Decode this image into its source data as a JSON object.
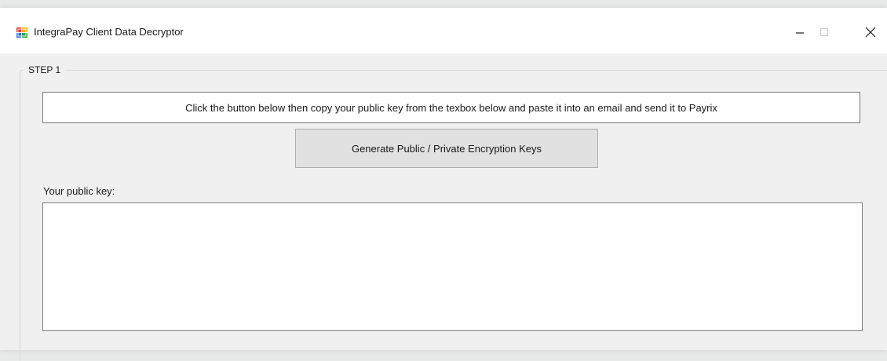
{
  "window": {
    "title": "IntegraPay Client Data Decryptor",
    "controls": {
      "minimize_icon": "minimize-icon",
      "maximize_icon": "maximize-icon",
      "close_icon": "close-icon"
    },
    "app_icon": "app-icon"
  },
  "step1": {
    "group_label": "STEP 1",
    "instruction": "Click the button below then copy your public key from the texbox below and paste it into an email and send it to Payrix",
    "generate_button_label": "Generate Public / Private Encryption Keys",
    "public_key_label": "Your public key:",
    "public_key_value": ""
  },
  "colors": {
    "window_background": "#f0f0f0",
    "titlebar_background": "#ffffff",
    "button_background": "#e1e1e1",
    "border": "#7a7a7a"
  }
}
